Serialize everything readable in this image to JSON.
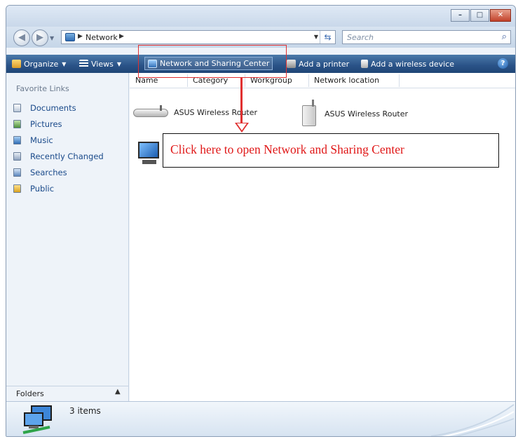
{
  "window": {
    "caption_buttons": [
      "minimize-icon",
      "maximize-icon",
      "close-icon"
    ]
  },
  "address_bar": {
    "breadcrumb": [
      "Network"
    ],
    "search_placeholder": "Search"
  },
  "toolbar": {
    "organize": "Organize",
    "views": "Views",
    "network_sharing_center": "Network and Sharing Center",
    "add_printer": "Add a printer",
    "add_wireless_device": "Add a wireless device"
  },
  "left_pane": {
    "title": "Favorite Links",
    "items": [
      {
        "label": "Documents",
        "icon": "documents-icon"
      },
      {
        "label": "Pictures",
        "icon": "pictures-icon"
      },
      {
        "label": "Music",
        "icon": "music-icon"
      },
      {
        "label": "Recently Changed",
        "icon": "recently-changed-icon"
      },
      {
        "label": "Searches",
        "icon": "searches-icon"
      },
      {
        "label": "Public",
        "icon": "public-folder-icon"
      }
    ],
    "folders_label": "Folders"
  },
  "content": {
    "columns": [
      "Name",
      "Category",
      "Workgroup",
      "Network location"
    ],
    "items": [
      {
        "label": "ASUS Wireless Router",
        "icon": "router-icon"
      },
      {
        "label": "ASUS Wireless Router",
        "icon": "router-tower-icon"
      },
      {
        "label": "",
        "icon": "computer-icon"
      }
    ]
  },
  "annotation": {
    "callout_text": "Click here to open Network and Sharing Center",
    "color": "#e01818"
  },
  "details": {
    "item_count": "3 items"
  }
}
